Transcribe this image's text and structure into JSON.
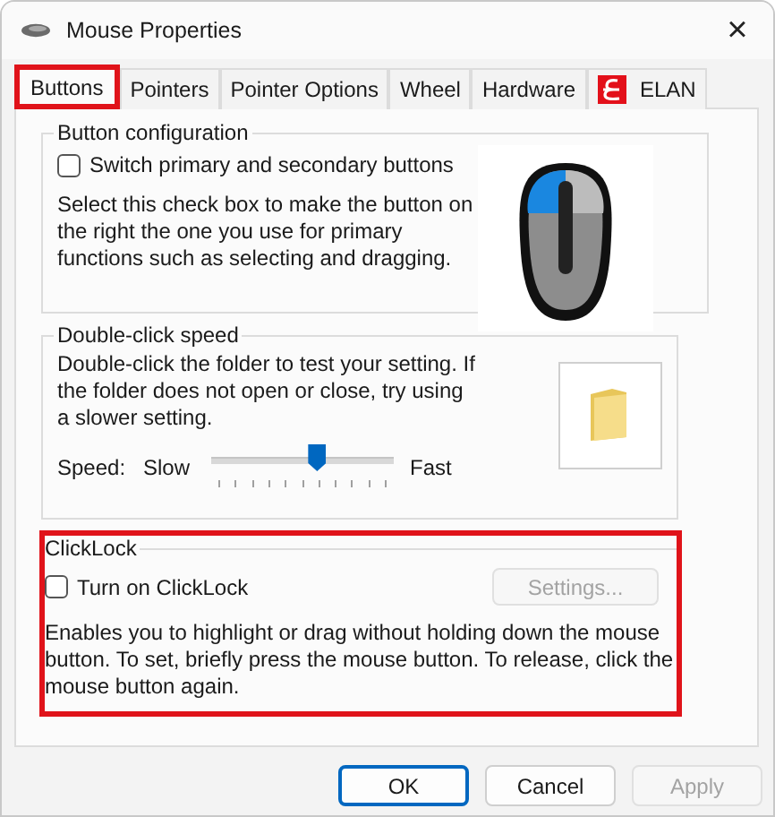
{
  "window": {
    "title": "Mouse Properties",
    "close": "×"
  },
  "tabs": [
    {
      "label": "Buttons",
      "selected": true,
      "highlighted": true,
      "kind": "text"
    },
    {
      "label": "Pointers",
      "selected": false,
      "highlighted": false,
      "kind": "text"
    },
    {
      "label": "Pointer Options",
      "selected": false,
      "highlighted": false,
      "kind": "text"
    },
    {
      "label": "Wheel",
      "selected": false,
      "highlighted": false,
      "kind": "text"
    },
    {
      "label": "Hardware",
      "selected": false,
      "highlighted": false,
      "kind": "text"
    },
    {
      "label": "ELAN",
      "selected": false,
      "highlighted": false,
      "kind": "logo"
    }
  ],
  "button_configuration": {
    "title": "Button configuration",
    "checkbox": {
      "label": "Switch primary and secondary buttons",
      "checked": false
    },
    "description": "Select this check box to make the button on the right the one you use for primary functions such as selecting and dragging."
  },
  "double_click_speed": {
    "title": "Double-click speed",
    "description": "Double-click the folder to test your setting. If the folder does not open or close, try using a slower setting.",
    "speed_label": "Speed:",
    "slow_label": "Slow",
    "fast_label": "Fast",
    "level": 0.58
  },
  "clicklock": {
    "title": "ClickLock",
    "highlighted": true,
    "checkbox": {
      "label": "Turn on ClickLock",
      "checked": false
    },
    "settings_button": {
      "label": "Settings...",
      "disabled": true
    },
    "description": "Enables you to highlight or drag without holding down the mouse button. To set, briefly press the mouse button. To release, click the mouse button again."
  },
  "buttons": [
    {
      "label": "OK",
      "default": true,
      "disabled": false
    },
    {
      "label": "Cancel",
      "default": false,
      "disabled": false
    },
    {
      "label": "Apply",
      "default": false,
      "disabled": true
    }
  ]
}
